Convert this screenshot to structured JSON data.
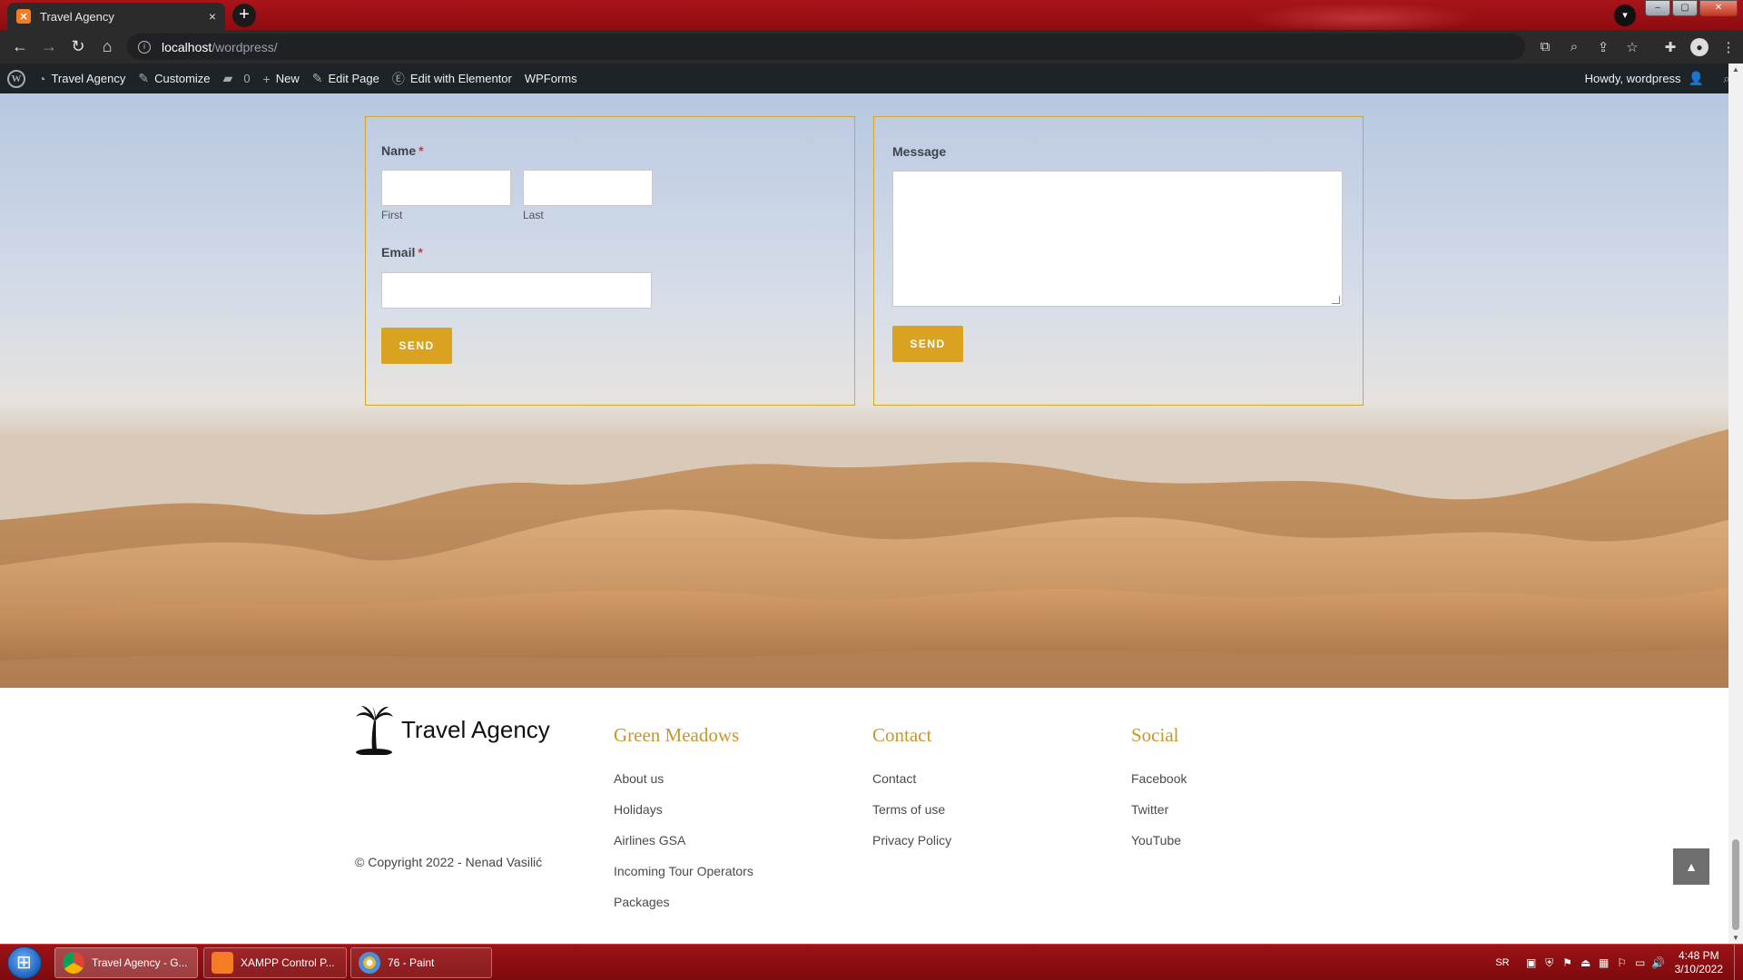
{
  "browser": {
    "tab_title": "Travel Agency",
    "tab_close": "×",
    "new_tab": "+",
    "url_host": "localhost",
    "url_path": "/wordpress/"
  },
  "wp_admin_bar": {
    "site_name": "Travel Agency",
    "customize": "Customize",
    "comments_count": "0",
    "new": "New",
    "edit_page": "Edit Page",
    "edit_elementor": "Edit with Elementor",
    "wpforms": "WPForms",
    "howdy": "Howdy, wordpress"
  },
  "contact_form_left": {
    "name_label": "Name",
    "required_mark": "*",
    "first_sublabel": "First",
    "last_sublabel": "Last",
    "email_label": "Email",
    "send_label": "SEND"
  },
  "contact_form_right": {
    "message_label": "Message",
    "send_label": "SEND"
  },
  "footer": {
    "brand": "Travel Agency",
    "columns": [
      {
        "title": "Green Meadows",
        "links": [
          "About us",
          "Holidays",
          "Airlines GSA",
          "Incoming Tour Operators",
          "Packages"
        ]
      },
      {
        "title": "Contact",
        "links": [
          "Contact",
          "Terms of use",
          "Privacy Policy"
        ]
      },
      {
        "title": "Social",
        "links": [
          "Facebook",
          "Twitter",
          "YouTube"
        ]
      }
    ],
    "copyright": "© Copyright 2022 - Nenad Vasilić"
  },
  "taskbar": {
    "tasks": [
      "Travel Agency - G...",
      "XAMPP Control P...",
      "76 - Paint"
    ],
    "language": "SR",
    "time": "4:48 PM",
    "date": "3/10/2022"
  },
  "colors": {
    "accent_gold": "#d9a220",
    "footer_heading": "#c8962b",
    "wp_bar": "#1d2327"
  }
}
